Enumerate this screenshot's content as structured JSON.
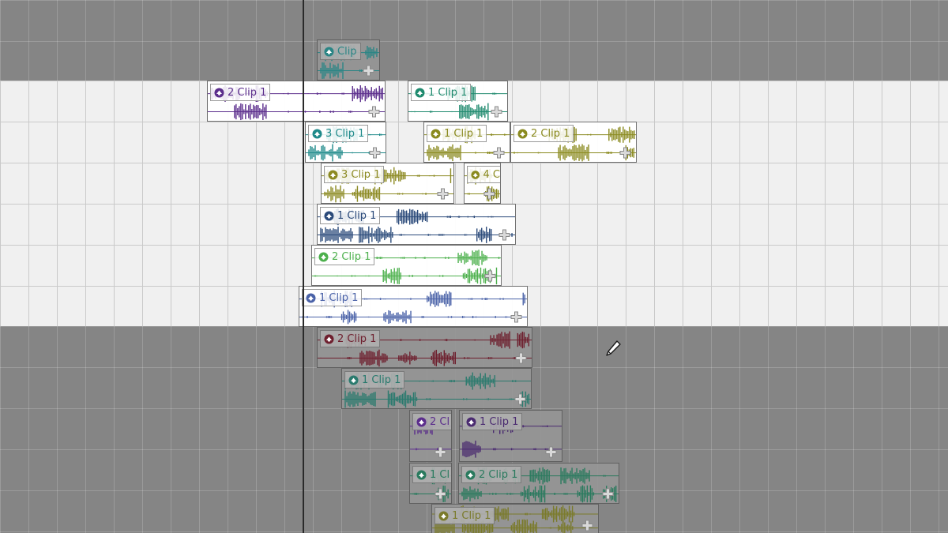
{
  "app": {
    "name": "multitrack-editor-timeline",
    "colors": {
      "grid_light": "#f0f0f0",
      "grid_dark": "#858585",
      "clip_selected_bg": "#ffffff",
      "clip_unselected_bg": "#969696"
    }
  },
  "timeline": {
    "clips": [
      {
        "label": "Clip",
        "color": "#2a8585",
        "selected": false,
        "icon": "clip-envelope-icon",
        "fx_icon": "fx-plus-icon"
      },
      {
        "label": "2 Clip 1",
        "color": "#5b2d8c",
        "selected": true,
        "icon": "clip-envelope-icon",
        "fx_icon": "fx-plus-icon"
      },
      {
        "label": "1 Clip 1",
        "color": "#1f8a6e",
        "selected": true,
        "icon": "clip-envelope-icon",
        "fx_icon": "fx-plus-icon"
      },
      {
        "label": "3 Clip 1",
        "color": "#1f8a8a",
        "selected": true,
        "icon": "clip-envelope-icon",
        "fx_icon": "fx-plus-icon"
      },
      {
        "label": "1 Clip 1",
        "color": "#8a8a1f",
        "selected": true,
        "icon": "clip-envelope-icon",
        "fx_icon": "fx-plus-icon"
      },
      {
        "label": "2 Clip 1",
        "color": "#8a8a1f",
        "selected": true,
        "icon": "clip-envelope-icon",
        "fx_icon": "fx-plus-icon"
      },
      {
        "label": "3 Clip 1",
        "color": "#8c8a22",
        "selected": true,
        "icon": "clip-envelope-icon",
        "fx_icon": "fx-plus-icon"
      },
      {
        "label": "4 C",
        "color": "#8a8a1f",
        "selected": true,
        "icon": "clip-envelope-icon",
        "fx_icon": "fx-plus-icon"
      },
      {
        "label": "1 Clip 1",
        "color": "#2b4a7a",
        "selected": true,
        "icon": "clip-envelope-icon",
        "fx_icon": "fx-plus-icon"
      },
      {
        "label": "2 Clip 1",
        "color": "#4cb04c",
        "selected": true,
        "icon": "clip-envelope-icon",
        "fx_icon": "fx-plus-icon"
      },
      {
        "label": "1 Clip 1",
        "color": "#4a62a8",
        "selected": true,
        "icon": "clip-envelope-icon",
        "fx_icon": "fx-plus-icon"
      },
      {
        "label": "2 Clip 1",
        "color": "#6e1f2e",
        "selected": false,
        "icon": "clip-envelope-icon",
        "fx_icon": "fx-plus-icon"
      },
      {
        "label": "1 Clip 1",
        "color": "#2a7a6e",
        "selected": false,
        "icon": "clip-envelope-icon",
        "fx_icon": "fx-plus-icon"
      },
      {
        "label": "2 Cl",
        "color": "#5b2d8c",
        "selected": false,
        "icon": "clip-envelope-icon",
        "fx_icon": "fx-plus-icon"
      },
      {
        "label": "1 Clip 1",
        "color": "#4a2a70",
        "selected": false,
        "icon": "clip-envelope-icon",
        "fx_icon": "fx-plus-icon"
      },
      {
        "label": "1 Cl",
        "color": "#2a7a5e",
        "selected": false,
        "icon": "clip-envelope-icon",
        "fx_icon": "fx-plus-icon"
      },
      {
        "label": "2 Clip 1",
        "color": "#2a7a5e",
        "selected": false,
        "icon": "clip-envelope-icon",
        "fx_icon": "fx-plus-icon"
      },
      {
        "label": "1 Clip 1",
        "color": "#7a7a2a",
        "selected": false,
        "icon": "clip-envelope-icon",
        "fx_icon": "fx-plus-icon"
      }
    ]
  }
}
